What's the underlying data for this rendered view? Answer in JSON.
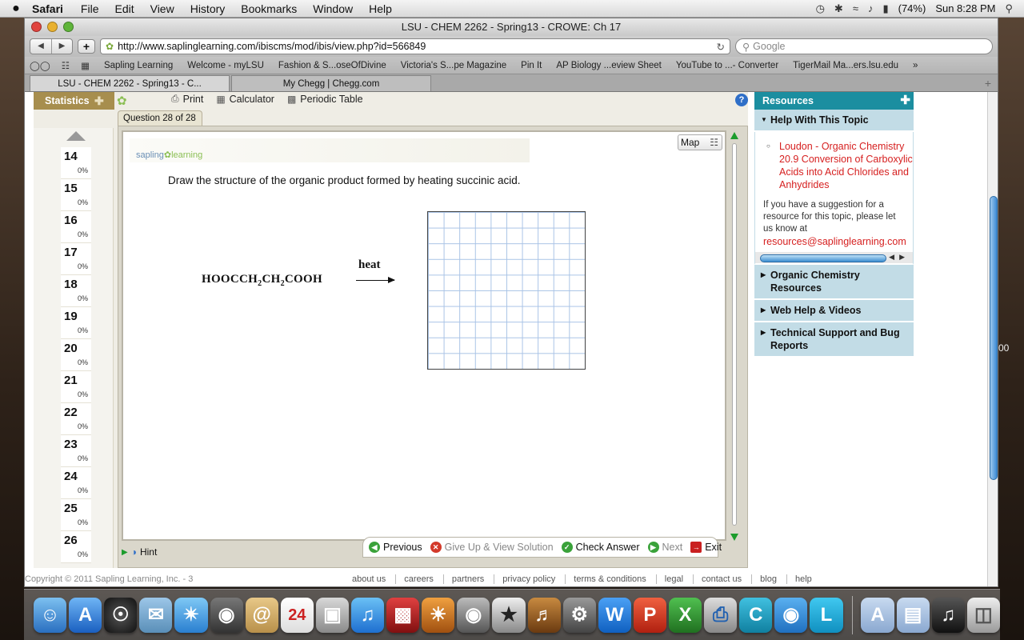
{
  "menubar": {
    "apple": "",
    "app": "Safari",
    "items": [
      "File",
      "Edit",
      "View",
      "History",
      "Bookmarks",
      "Window",
      "Help"
    ],
    "battery": "(74%)",
    "clock": "Sun 8:28 PM"
  },
  "window": {
    "title": "LSU - CHEM 2262 - Spring13 - CROWE: Ch 17",
    "url": "http://www.saplinglearning.com/ibiscms/mod/ibis/view.php?id=566849",
    "search_placeholder": "Google",
    "bookmarks": [
      "Sapling Learning",
      "Welcome - myLSU",
      "Fashion & S...oseOfDivine",
      "Victoria's S...pe Magazine",
      "Pin It",
      "AP Biology ...eview Sheet",
      "YouTube to ...- Converter",
      "TigerMail Ma...ers.lsu.edu"
    ],
    "tabs": [
      "LSU - CHEM 2262 - Spring13 - C...",
      "My Chegg | Chegg.com"
    ]
  },
  "app": {
    "statistics_label": "Statistics",
    "tools": [
      "Print",
      "Calculator",
      "Periodic Table"
    ],
    "question_tab": "Question 28 of 28",
    "map_label": "Map",
    "logo_text": "sapling",
    "logo_text2": "learning",
    "question_text": "Draw the structure of the organic product formed by heating succinic acid.",
    "reactant": {
      "p1": "HOOCCH",
      "s1": "2",
      "p2": "CH",
      "s2": "2",
      "p3": "COOH"
    },
    "reagent": "heat",
    "questions": [
      {
        "num": "14",
        "pct": "0%"
      },
      {
        "num": "15",
        "pct": "0%"
      },
      {
        "num": "16",
        "pct": "0%"
      },
      {
        "num": "17",
        "pct": "0%"
      },
      {
        "num": "18",
        "pct": "0%"
      },
      {
        "num": "19",
        "pct": "0%"
      },
      {
        "num": "20",
        "pct": "0%"
      },
      {
        "num": "21",
        "pct": "0%"
      },
      {
        "num": "22",
        "pct": "0%"
      },
      {
        "num": "23",
        "pct": "0%"
      },
      {
        "num": "24",
        "pct": "0%"
      },
      {
        "num": "25",
        "pct": "0%"
      },
      {
        "num": "26",
        "pct": "0%"
      }
    ],
    "hint_label": "Hint",
    "actions": {
      "previous": "Previous",
      "giveup": "Give Up & View Solution",
      "check": "Check Answer",
      "next": "Next",
      "exit": "Exit"
    }
  },
  "resources": {
    "header": "Resources",
    "help_section": "Help With This Topic",
    "link": "Loudon - Organic Chemistry 20.9 Conversion of Carboxylic Acids into Acid Chlorides and Anhydrides",
    "suggestion": "If you have a suggestion for a resource for this topic, please let us know at",
    "email": "resources@saplinglearning.com",
    "sections": [
      "Organic Chemistry Resources",
      "Web Help & Videos",
      "Technical Support and Bug Reports"
    ]
  },
  "footer": {
    "copyright": "Copyright © 2011 Sapling Learning, Inc. - 3",
    "links": [
      "about us",
      "careers",
      "partners",
      "privacy policy",
      "terms & conditions",
      "legal",
      "contact us",
      "blog",
      "help"
    ]
  },
  "desktop": {
    "behind_text": "00",
    "dock_calendar": "24"
  }
}
